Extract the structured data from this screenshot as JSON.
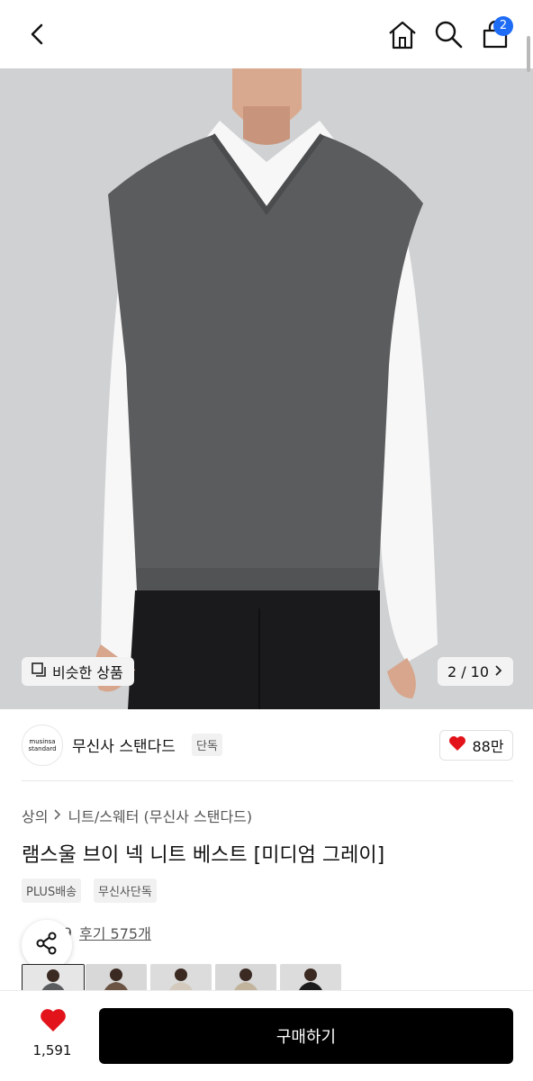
{
  "header": {
    "cart_count": "2",
    "icons": [
      "back-icon",
      "home-icon",
      "search-icon",
      "cart-icon"
    ]
  },
  "hero": {
    "similar_label": "비슷한 상품",
    "page_indicator": "2 / 10"
  },
  "brand": {
    "logo_text": "musinsa standard",
    "name": "무신사 스탠다드",
    "badge": "단독",
    "likes": "88만"
  },
  "product": {
    "breadcrumb": [
      "상의",
      "니트/스웨터 (무신사 스탠다드)"
    ],
    "title": "램스울 브이 넥 니트 베스트 [미디엄 그레이]",
    "tags": [
      "PLUS배송",
      "무신사단독"
    ],
    "rating_partial": "9",
    "review_label": "후기 575개"
  },
  "thumbnails": [
    "medium-gray",
    "brown",
    "light-beige",
    "beige",
    "black"
  ],
  "bottom": {
    "wish_count": "1,591",
    "buy_label": "구매하기"
  },
  "colors": {
    "accent_blue": "#1e6cf5",
    "heart_red": "#e3131b",
    "buy_black": "#000000"
  }
}
